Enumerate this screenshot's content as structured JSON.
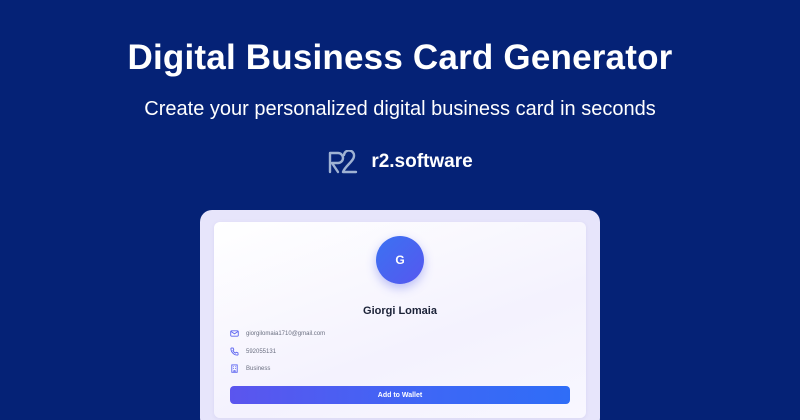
{
  "hero": {
    "title": "Digital Business Card Generator",
    "subtitle": "Create your personalized digital business card in seconds"
  },
  "brand": {
    "logo_icon": "r2-logo-icon",
    "name": "r2.software"
  },
  "card": {
    "avatar_initial": "G",
    "name": "Giorgi Lomaia",
    "email": "giorgilomaia1710@gmail.com",
    "phone": "592055131",
    "category": "Business",
    "button_label": "Add to Wallet"
  },
  "icons": {
    "email": "mail-icon",
    "phone": "phone-icon",
    "category": "building-icon"
  },
  "colors": {
    "background": "#052276",
    "card_frame": "#e7e5fb",
    "accent": "#4b5ff1",
    "name_text": "#1b2237"
  }
}
